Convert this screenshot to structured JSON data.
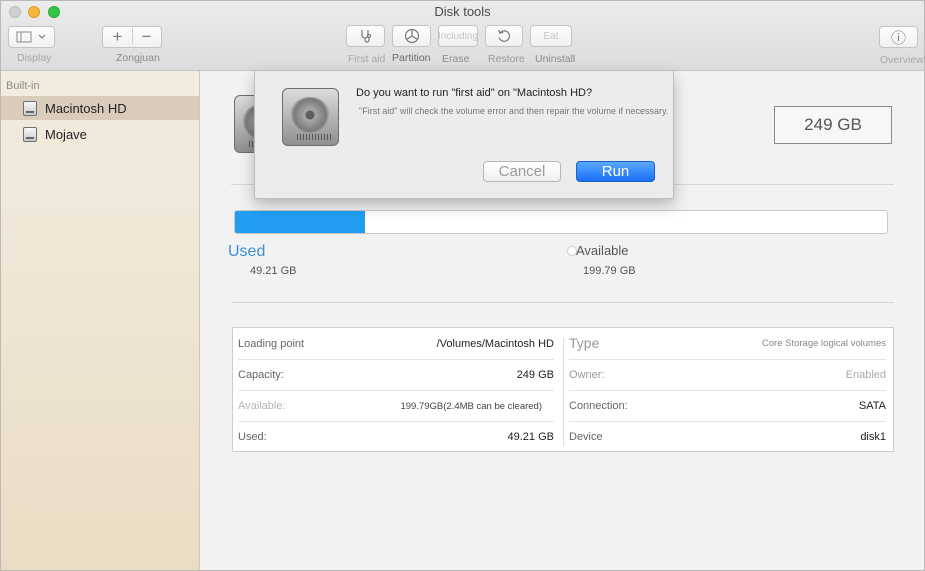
{
  "window": {
    "title": "Disk tools"
  },
  "toolbar": {
    "display_label": "Display",
    "add_symbol": "+",
    "remove_symbol": "−",
    "group_label": "Zongjuan",
    "first_aid_label": "First aid",
    "partition_label": "Partition",
    "erase_button_text": "Including",
    "erase_label": "Erase",
    "restore_label": "Restore",
    "uninstall_button_text": "Eat",
    "uninstall_label": "Uninstall",
    "overview_label": "Overview",
    "info_symbol": "ⓘ"
  },
  "sidebar": {
    "header": "Built-in",
    "items": [
      {
        "label": "Macintosh HD",
        "selected": true
      },
      {
        "label": "Mojave",
        "selected": false
      }
    ]
  },
  "volume": {
    "size": "249 GB",
    "used_fraction": 0.2,
    "used_label": "Used",
    "used_value": "49.21 GB",
    "available_label": "Available",
    "available_value": "199.79 GB"
  },
  "info": {
    "left": [
      {
        "key": "Loading point",
        "value": "/Volumes/Macintosh HD"
      },
      {
        "key": "Capacity:",
        "value": "249 GB"
      },
      {
        "key": "Available:",
        "value": "199.79GB(2.4MB can be cleared)"
      },
      {
        "key": "Used:",
        "value": "49.21 GB"
      }
    ],
    "right": [
      {
        "key": "Type",
        "value": "Core Storage logical volumes"
      },
      {
        "key": "Owner:",
        "value": "Enabled"
      },
      {
        "key": "Connection:",
        "value": "SATA"
      },
      {
        "key": "Device",
        "value": "disk1"
      }
    ]
  },
  "dialog": {
    "question": "Do you want to run \"first aid\" on \"Macintosh HD?",
    "description": "\"First aid\" will check the volume error and then repair the volume if necessary.",
    "cancel_label": "Cancel",
    "run_label": "Run"
  },
  "colors": {
    "accent": "#219ef1",
    "run_button": "#1a6ef5",
    "used_text": "#3d8fd6"
  }
}
